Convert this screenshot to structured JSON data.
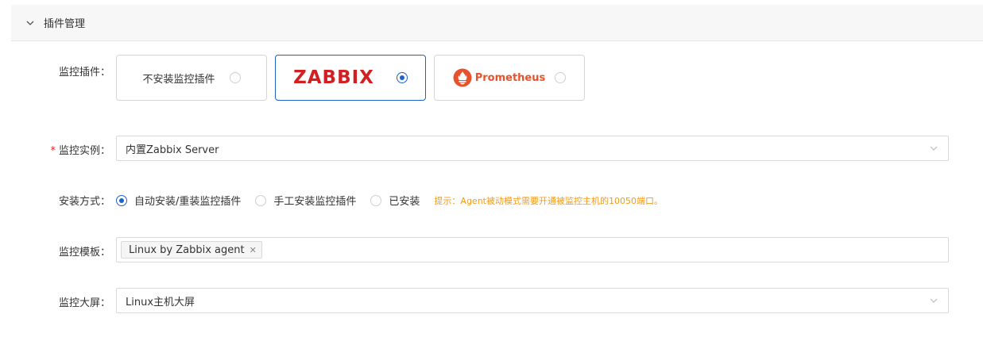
{
  "section": {
    "title": "插件管理",
    "toggle_icon": "chevron-down-icon"
  },
  "plugin": {
    "label": "监控插件：",
    "options": [
      {
        "label": "不安装监控插件",
        "selected": false
      },
      {
        "logo_text": "ZABBIX",
        "selected": true
      },
      {
        "logo_text": "Prometheus",
        "selected": false
      }
    ]
  },
  "instance": {
    "required_mark": "*",
    "label": "监控实例：",
    "value": "内置Zabbix Server"
  },
  "install": {
    "label": "安装方式：",
    "options": [
      {
        "label": "自动安装/重装监控插件",
        "selected": true
      },
      {
        "label": "手工安装监控插件",
        "selected": false
      },
      {
        "label": "已安装",
        "selected": false
      }
    ],
    "hint": "提示：Agent被动模式需要开通被监控主机的10050端口。"
  },
  "template": {
    "label": "监控模板：",
    "tags": [
      "Linux by Zabbix agent"
    ]
  },
  "dashboard": {
    "label": "监控大屏：",
    "value": "Linux主机大屏"
  },
  "colors": {
    "accent": "#1f62c7",
    "zabbix": "#d21f22",
    "prometheus": "#e6522c",
    "hint": "#f09a1b",
    "required": "#e02020"
  }
}
